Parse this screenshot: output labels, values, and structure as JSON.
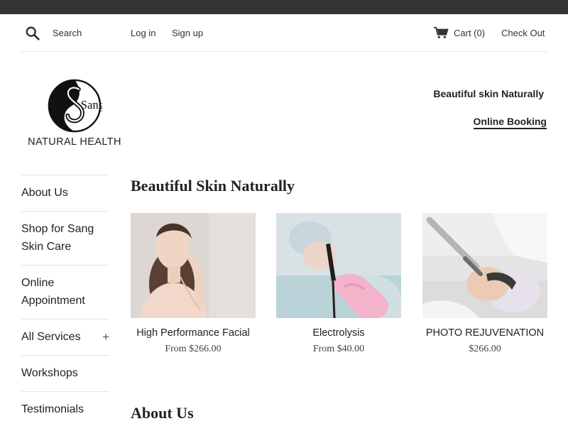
{
  "header": {
    "search_label": "Search",
    "login": "Log in",
    "signup": "Sign up",
    "cart": "Cart (0)",
    "checkout": "Check Out"
  },
  "brand": {
    "monogram": "Sang",
    "name": "NATURAL HEALTH",
    "tagline": "Beautiful skin Naturally",
    "booking": "Online Booking"
  },
  "sidebar": {
    "items": [
      {
        "label": "About Us"
      },
      {
        "label": "Shop for Sang Skin Care"
      },
      {
        "label": "Online Appointment"
      },
      {
        "label": "All Services",
        "expand": "+"
      },
      {
        "label": "Workshops"
      },
      {
        "label": "Testimonials"
      }
    ]
  },
  "main": {
    "section_title": "Beautiful Skin Naturally",
    "products": [
      {
        "title": "High Performance Facial",
        "price": "From $266.00"
      },
      {
        "title": "Electrolysis",
        "price": "From $40.00"
      },
      {
        "title": "PHOTO REJUVENATION",
        "price": "$266.00"
      }
    ],
    "about_title": "About Us"
  },
  "icons": {
    "search": "search-icon",
    "cart": "cart-icon",
    "expand": "plus-icon"
  },
  "colors": {
    "topbar": "#333333",
    "text": "#222222",
    "divider": "#e5e5e5"
  }
}
